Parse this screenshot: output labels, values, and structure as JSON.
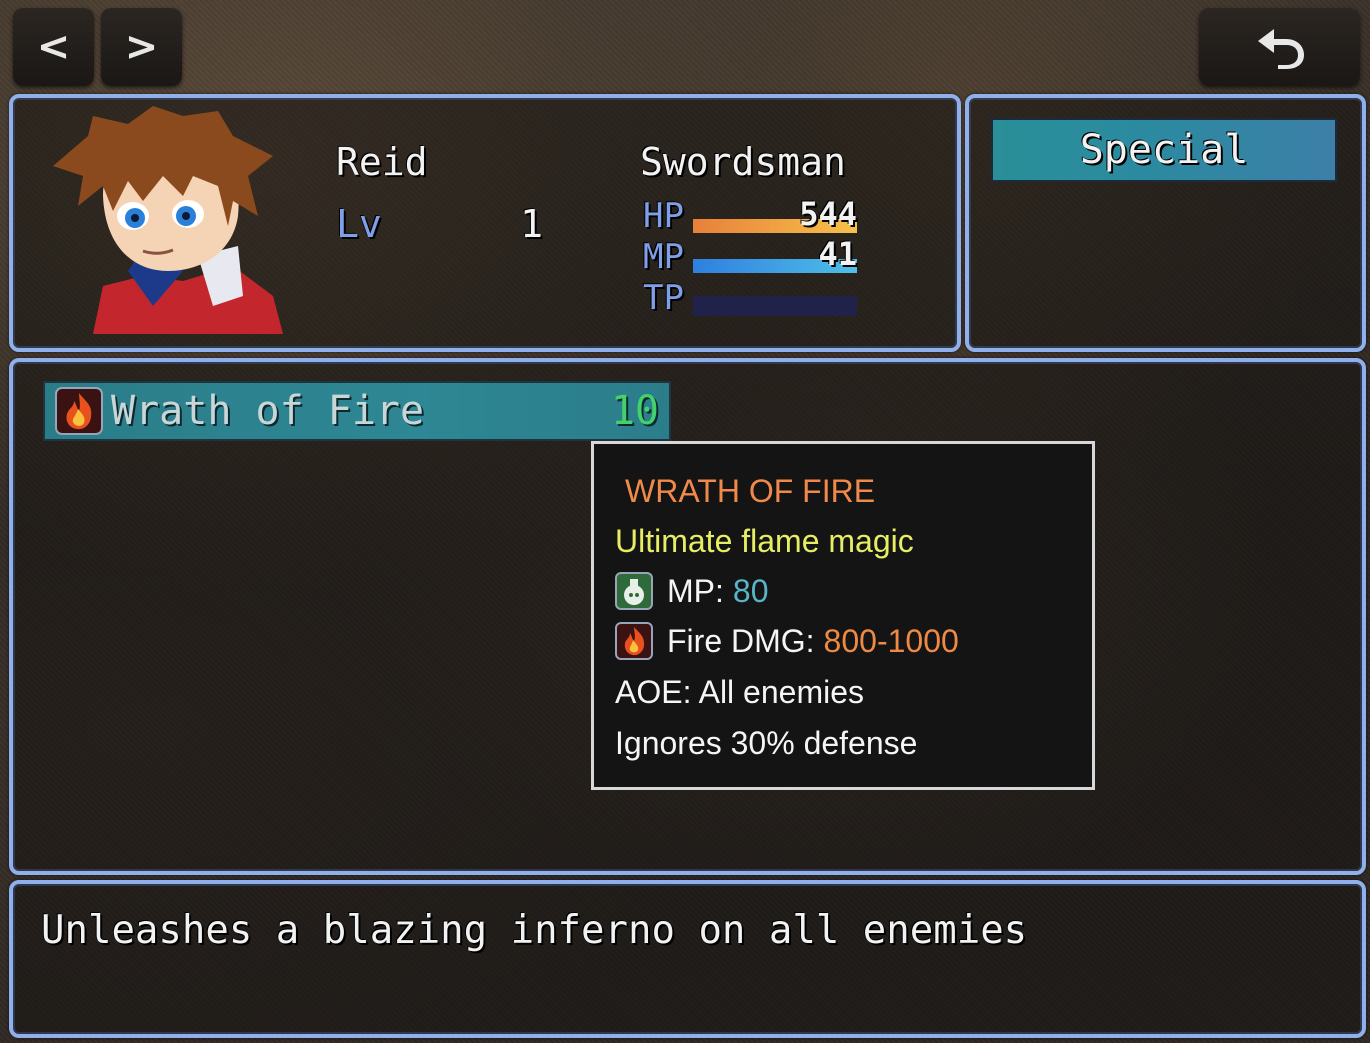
{
  "nav": {
    "prev_label": "<",
    "next_label": ">",
    "back_icon": "undo-arrow-icon"
  },
  "actor": {
    "name": "Reid",
    "class": "Swordsman",
    "level_label": "Lv",
    "level": "1",
    "hp_label": "HP",
    "hp_value": "544",
    "hp_fill": 1.0,
    "mp_label": "MP",
    "mp_value": "41",
    "mp_fill": 1.0,
    "tp_label": "TP",
    "tp_fill": 0.0,
    "portrait": "hero-portrait-icon"
  },
  "category": {
    "selected": "Special"
  },
  "skill": {
    "name": "Wrath of Fire",
    "cost": "10",
    "icon": "flame-icon"
  },
  "tooltip": {
    "title": "WRATH OF FIRE",
    "subtitle": "Ultimate flame magic",
    "mp_label": "MP:",
    "mp_value": "80",
    "mp_icon": "potion-icon",
    "dmg_label": "Fire DMG:",
    "dmg_value": "800-1000",
    "dmg_icon": "flame-icon",
    "aoe": "AOE: All enemies",
    "ignore": "Ignores 30% defense"
  },
  "help": {
    "text": "Unleashes a blazing inferno on all enemies"
  },
  "colors": {
    "window_border": "#8fb0ea",
    "hp_gauge": "#f0a840",
    "mp_gauge": "#3ea0e0",
    "tp_gauge": "#20224a",
    "skill_cost": "#44d06a",
    "tooltip_title": "#f08a4a",
    "tooltip_subtitle": "#e7ee63"
  }
}
